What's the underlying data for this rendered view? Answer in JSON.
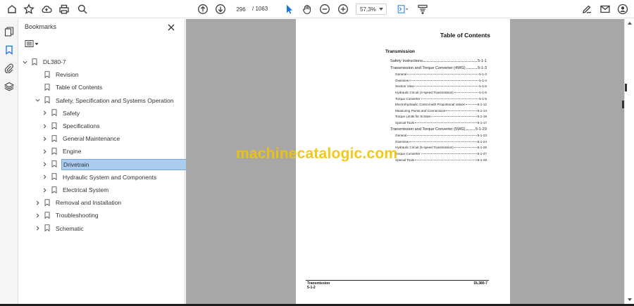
{
  "toolbar": {
    "page_current": "296",
    "page_total": "/ 1063",
    "zoom": "57,3%"
  },
  "panel": {
    "title": "Bookmarks"
  },
  "bookmarks": [
    {
      "label": "DL380-7",
      "level": 0,
      "expanded": true,
      "has_children": true
    },
    {
      "label": "Revision",
      "level": 1,
      "has_children": false
    },
    {
      "label": "Table of Contents",
      "level": 1,
      "has_children": false
    },
    {
      "label": "Safety, Specification and Systems Operation",
      "level": 1,
      "expanded": true,
      "has_children": true
    },
    {
      "label": "Safety",
      "level": 2,
      "has_children": true
    },
    {
      "label": "Specifications",
      "level": 2,
      "has_children": true
    },
    {
      "label": "General Maintenance",
      "level": 2,
      "has_children": true
    },
    {
      "label": "Engine",
      "level": 2,
      "has_children": true
    },
    {
      "label": "Drivetrain",
      "level": 2,
      "has_children": true,
      "selected": true
    },
    {
      "label": "Hydraulic System and Components",
      "level": 2,
      "has_children": true
    },
    {
      "label": "Electrical System",
      "level": 2,
      "has_children": true
    },
    {
      "label": "Removal and Installation",
      "level": 1,
      "has_children": true
    },
    {
      "label": "Troubleshooting",
      "level": 1,
      "has_children": true
    },
    {
      "label": "Schematic",
      "level": 1,
      "has_children": true
    }
  ],
  "document": {
    "title": "Table of Contents",
    "section": "Transmission",
    "toc": [
      {
        "text": "Safety Instructions",
        "page": "5-1-1",
        "level": 1
      },
      {
        "text": "Transmission and Torque Converter (4WG)",
        "page": "5-1-3",
        "level": 1
      },
      {
        "text": "General",
        "page": "5-1-3",
        "level": 2
      },
      {
        "text": "Overview",
        "page": "5-1-4",
        "level": 2
      },
      {
        "text": "Section View",
        "page": "5-1-6",
        "level": 2
      },
      {
        "text": "Hydraulic Circuit (4-speed Transmission)",
        "page": "5-1-8",
        "level": 2
      },
      {
        "text": "Torque Converter",
        "page": "5-1-9",
        "level": 2
      },
      {
        "text": "Electrohydraulic Control with Proportional Valves",
        "page": "5-1-12",
        "level": 2
      },
      {
        "text": "Measuring Points and Connections",
        "page": "5-1-14",
        "level": 2
      },
      {
        "text": "Torque Limits for Screws",
        "page": "5-1-16",
        "level": 2
      },
      {
        "text": "Special Tools",
        "page": "5-1-17",
        "level": 2
      },
      {
        "text": "Transmission and Torque Converter (5WG)",
        "page": "5-1-23",
        "level": 1
      },
      {
        "text": "General",
        "page": "5-1-23",
        "level": 2
      },
      {
        "text": "Overview",
        "page": "5-1-24",
        "level": 2
      },
      {
        "text": "Hydraulic Circuit (5-speed Transmission)",
        "page": "5-1-26",
        "level": 2
      },
      {
        "text": "Torque Converter",
        "page": "5-1-27",
        "level": 2
      },
      {
        "text": "Special Tools",
        "page": "5-1-28",
        "level": 2
      }
    ],
    "footer_left_1": "Transmission",
    "footer_left_2": "5-1-2",
    "footer_right": "DL380-7"
  },
  "watermark": "machinecatalogic.com",
  "colors": {
    "accent": "#1473e6",
    "selection": "#aaccee",
    "doc_background": "#a7a7a7",
    "watermark": "#f2c500"
  },
  "icons": {
    "toolbar_left": [
      "home-icon",
      "star-icon",
      "cloud-upload-icon",
      "print-icon",
      "zoom-search-icon"
    ],
    "toolbar_center": [
      "page-up-icon",
      "page-down-icon",
      "cursor-select-icon",
      "hand-tool-icon",
      "zoom-out-icon",
      "zoom-in-icon",
      "fit-page-icon",
      "read-mode-icon"
    ],
    "toolbar_right": [
      "edit-sign-icon",
      "mail-icon",
      "account-icon"
    ],
    "rail": [
      "pages-icon",
      "bookmark-icon",
      "attachment-icon",
      "layers-icon"
    ]
  }
}
